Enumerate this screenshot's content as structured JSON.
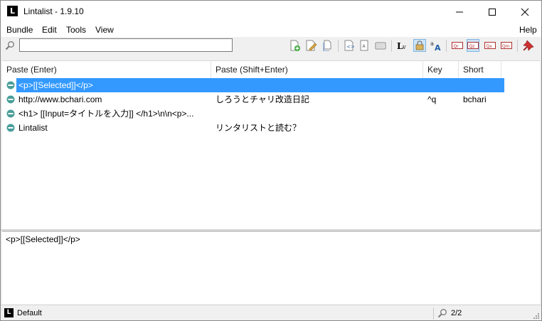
{
  "window": {
    "title": "Lintalist - 1.9.10",
    "app_icon": "L"
  },
  "menu": [
    "Bundle",
    "Edit",
    "Tools",
    "View"
  ],
  "help": "Help",
  "search": {
    "value": "",
    "placeholder": ""
  },
  "columns": [
    "Paste (Enter)",
    "Paste (Shift+Enter)",
    "Key",
    "Short"
  ],
  "rows": [
    {
      "paste": "<p>[[Selected]]</p>",
      "paste_shift": "",
      "key": "",
      "short": "",
      "selected": true
    },
    {
      "paste": "http://www.bchari.com",
      "paste_shift": "しろうとチャリ改造日記",
      "key": "^q",
      "short": "bchari",
      "selected": false
    },
    {
      "paste": "<h1> [[Input=タイトルを入力]] </h1>\\n\\n<p>...",
      "paste_shift": "",
      "key": "",
      "short": "",
      "selected": false
    },
    {
      "paste": "Lintalist",
      "paste_shift": "リンタリストと読む？",
      "key": "",
      "short": "",
      "selected": false
    }
  ],
  "preview": "<p>[[Selected]]</p>",
  "status": {
    "bundle": "Default",
    "count": "2/2",
    "icon": "L"
  },
  "colors": {
    "selection": "#3399ff",
    "row_icon": "#4a9e9a"
  }
}
